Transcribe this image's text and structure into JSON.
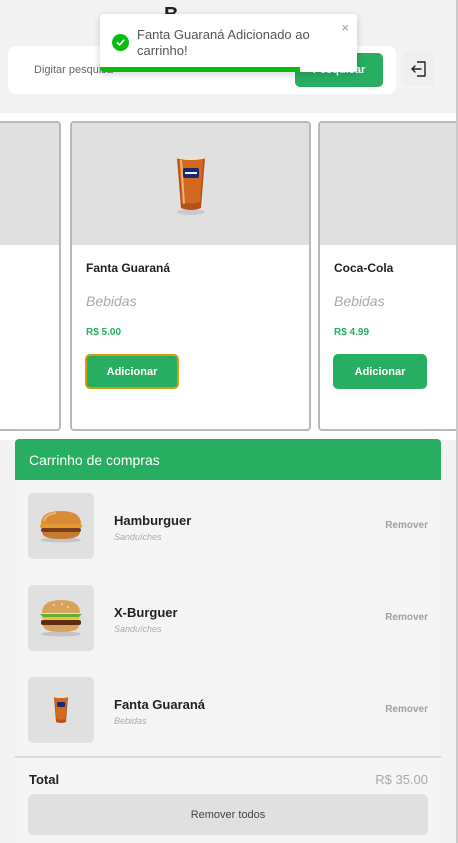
{
  "header": {
    "letter": "B",
    "search_placeholder": "Digitar pesquisa",
    "search_button_label": "Pesquisar"
  },
  "toast": {
    "message": "Fanta Guaraná Adicionado ao carrinho!",
    "close_symbol": "×",
    "progress_fraction": 0.78,
    "color": "#07bc0c"
  },
  "products": [
    {
      "name": "",
      "category": "",
      "price": "",
      "button": ""
    },
    {
      "name": "Fanta Guaraná",
      "category": "Bebidas",
      "price": "R$ 5.00",
      "button": "Adicionar",
      "icon": "fanta-cup-icon"
    },
    {
      "name": "Coca-Cola",
      "category": "Bebidas",
      "price": "R$ 4.99",
      "button": "Adicionar",
      "icon": "coca-cola-cup-icon"
    }
  ],
  "cart": {
    "title": "Carrinho de compras",
    "items": [
      {
        "name": "Hamburguer",
        "category": "Sanduíches",
        "remove_label": "Remover",
        "icon": "hamburger-icon"
      },
      {
        "name": "X-Burguer",
        "category": "Sanduíches",
        "remove_label": "Remover",
        "icon": "x-burger-icon"
      },
      {
        "name": "Fanta Guaraná",
        "category": "Bebidas",
        "remove_label": "Remover",
        "icon": "fanta-cup-icon"
      }
    ],
    "total_label": "Total",
    "total_value": "R$ 35.00",
    "remove_all_label": "Remover todos"
  },
  "colors": {
    "accent": "#27ae60",
    "focus_border": "#d39b13"
  }
}
